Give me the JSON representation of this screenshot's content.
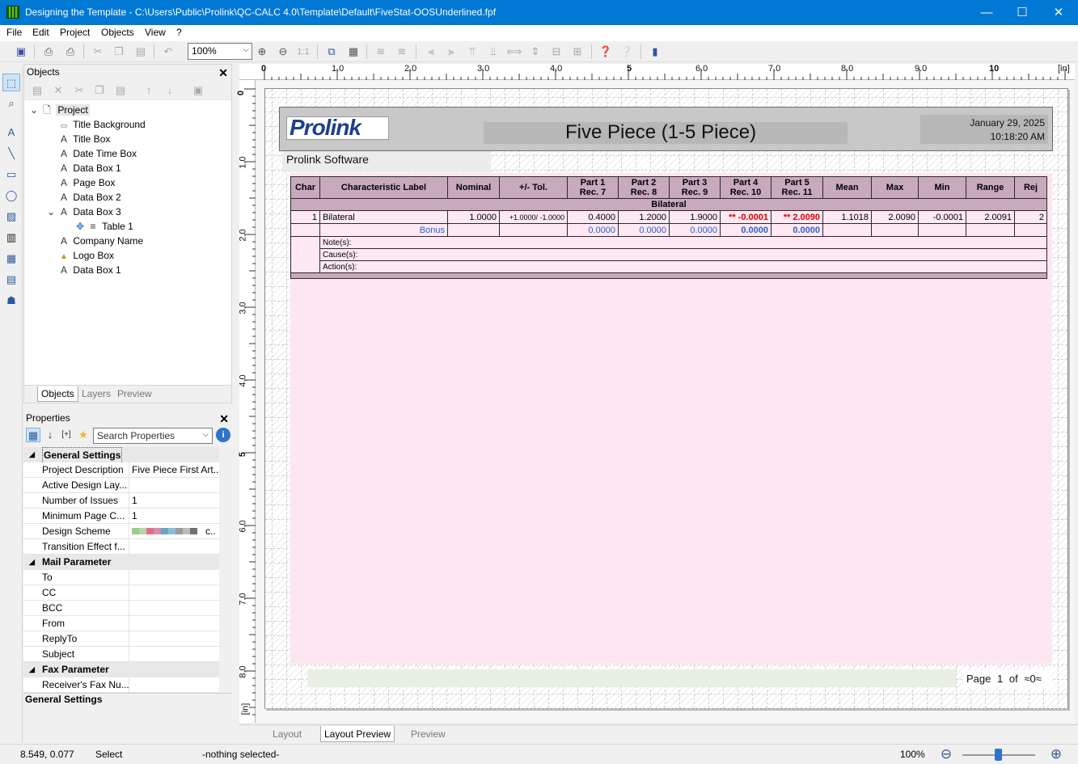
{
  "window": {
    "title": "Designing the Template - C:\\Users\\Public\\Prolink\\QC-CALC 4.0\\Template\\Default\\FiveStat-OOSUnderlined.fpf",
    "minimize": "—",
    "maximize": "☐",
    "close": "✕"
  },
  "menu": [
    "File",
    "Edit",
    "Project",
    "Objects",
    "View",
    "?"
  ],
  "toolbar": {
    "zoom_value": "100%",
    "ratio_label": "1:1"
  },
  "objects_panel": {
    "title": "Objects",
    "tree": [
      {
        "label": "Project",
        "icon": "page-icon"
      },
      {
        "label": "Title Background",
        "icon": "rectangle-icon"
      },
      {
        "label": "Title Box",
        "icon": "text-icon"
      },
      {
        "label": "Date Time Box",
        "icon": "text-icon"
      },
      {
        "label": "Data Box 1",
        "icon": "text-icon"
      },
      {
        "label": "Page Box",
        "icon": "text-icon"
      },
      {
        "label": "Data Box 2",
        "icon": "text-icon"
      },
      {
        "label": "Data Box 3",
        "icon": "text-icon"
      },
      {
        "label": "Table 1",
        "icon": "table-icon"
      },
      {
        "label": "Company Name",
        "icon": "text-icon"
      },
      {
        "label": "Logo Box",
        "icon": "image-icon"
      },
      {
        "label": "Data Box 1",
        "icon": "text-icon"
      }
    ],
    "tabs": [
      "Objects",
      "Layers",
      "Preview"
    ]
  },
  "properties_panel": {
    "title": "Properties",
    "search_placeholder": "Search Properties",
    "categories": [
      {
        "name": "General Settings",
        "rows": [
          {
            "name": "Project Description",
            "value": "Five Piece First Art..."
          },
          {
            "name": "Active Design Lay...",
            "value": ""
          },
          {
            "name": "Number of Issues",
            "value": "1"
          },
          {
            "name": "Minimum Page C...",
            "value": "1"
          },
          {
            "name": "Design Scheme",
            "value": "c.."
          },
          {
            "name": "Transition Effect f...",
            "value": ""
          }
        ]
      },
      {
        "name": "Mail Parameter",
        "rows": [
          {
            "name": "To",
            "value": ""
          },
          {
            "name": "CC",
            "value": ""
          },
          {
            "name": "BCC",
            "value": ""
          },
          {
            "name": "From",
            "value": ""
          },
          {
            "name": "ReplyTo",
            "value": ""
          },
          {
            "name": "Subject",
            "value": ""
          }
        ]
      },
      {
        "name": "Fax Parameter",
        "rows": [
          {
            "name": "Receiver's Fax Nu...",
            "value": ""
          }
        ]
      }
    ],
    "footer_label": "General Settings",
    "scheme_colors": [
      "#9fc98c",
      "#b5d7a3",
      "#e06c8c",
      "#d88ca8",
      "#6aa5c9",
      "#8ebcd8",
      "#9a9a9a",
      "#bdbdbd",
      "#707070"
    ]
  },
  "ruler": {
    "top_labels": [
      "0",
      "1.0",
      "2.0",
      "3.0",
      "4.0",
      "5",
      "6.0",
      "7.0",
      "8.0",
      "9.0",
      "10"
    ],
    "top_unit": "[in]",
    "left_labels": [
      "0",
      "1.0",
      "2.0",
      "3.0",
      "4.0",
      "5",
      "6.0",
      "7.0",
      "8.0"
    ],
    "left_unit": "[in]"
  },
  "report": {
    "logo_text": "Prolink",
    "title": "Five Piece (1-5 Piece)",
    "date": "January 29, 2025",
    "time": "10:18:20 AM",
    "company": "Prolink Software",
    "table": {
      "headers": [
        [
          "Char"
        ],
        [
          "Characteristic Label"
        ],
        [
          "Nominal"
        ],
        [
          "+/- Tol."
        ],
        [
          "Part 1",
          "Rec. 7"
        ],
        [
          "Part 2",
          "Rec. 8"
        ],
        [
          "Part 3",
          "Rec. 9"
        ],
        [
          "Part 4",
          "Rec. 10"
        ],
        [
          "Part 5",
          "Rec. 11"
        ],
        [
          "Mean"
        ],
        [
          "Max"
        ],
        [
          "Min"
        ],
        [
          "Range"
        ],
        [
          "Rej"
        ]
      ],
      "group_label": "Bilateral",
      "row1": {
        "char": "1",
        "label": "Bilateral",
        "nominal": "1.0000",
        "tol": "+1.0000/  -1.0000",
        "p1": "0.4000",
        "p2": "1.2000",
        "p3": "1.9000",
        "p4": "**  -0.0001",
        "p5": "**  2.0090",
        "mean": "1.1018",
        "max": "2.0090",
        "min": "-0.0001",
        "range": "2.0091",
        "rej": "2"
      },
      "row2": {
        "label": "Bonus",
        "p1": "0.0000",
        "p2": "0.0000",
        "p3": "0.0000",
        "p4": "0.0000",
        "p5": "0.0000"
      },
      "notes": [
        "Note(s):",
        "Cause(s):",
        "Action(s):"
      ]
    },
    "page_label": "Page",
    "page_num": "1",
    "of_label": "of",
    "page_total": "≈0≈"
  },
  "bottom_tabs": [
    "Layout",
    "Layout Preview",
    "Preview"
  ],
  "status": {
    "coords": "8.549, 0.077",
    "mode": "Select",
    "selection": "-nothing selected-",
    "zoom": "100%"
  }
}
